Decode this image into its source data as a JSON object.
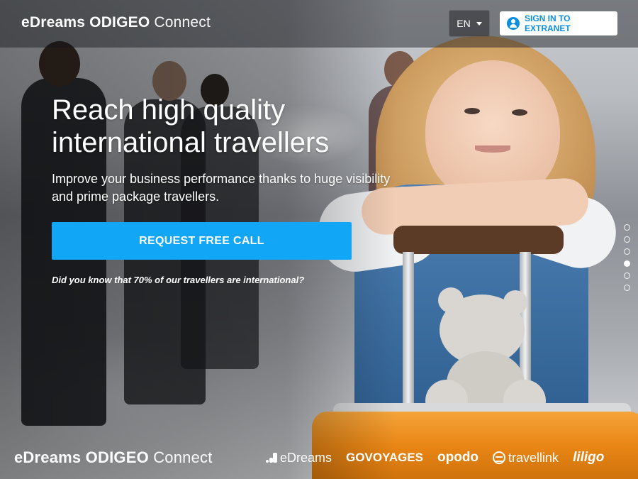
{
  "header": {
    "logo": {
      "bold": "eDreams ODIGEO",
      "light": "Connect"
    },
    "language": "EN",
    "signin_label": "SIGN IN TO EXTRANET"
  },
  "hero": {
    "title_line1": "Reach high quality",
    "title_line2": "international travellers",
    "subtitle_line1": "Improve your business performance thanks to huge visibility",
    "subtitle_line2": "and prime package travellers.",
    "cta_label": "REQUEST FREE CALL",
    "note": "Did you know that 70% of our travellers are international?"
  },
  "carousel": {
    "total": 6,
    "active_index": 3
  },
  "footer": {
    "logo": {
      "bold": "eDreams ODIGEO",
      "light": "Connect"
    },
    "brands": [
      {
        "name": "eDreams",
        "icon": "edreams-mark-icon"
      },
      {
        "name": "GOVOYAGES"
      },
      {
        "name": "opodo"
      },
      {
        "name": "travellink",
        "icon": "globe-icon"
      },
      {
        "name": "liligo"
      }
    ]
  },
  "colors": {
    "accent": "#12a7f6",
    "link": "#0a8fe0",
    "suitcase": "#e88514"
  }
}
